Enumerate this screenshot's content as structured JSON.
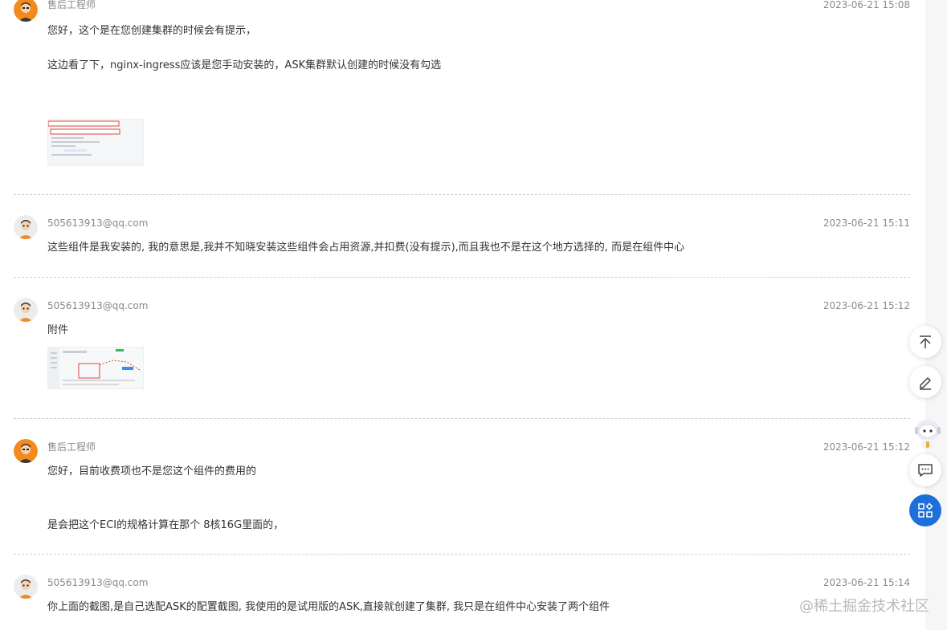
{
  "messages": [
    {
      "author": "售后工程师",
      "role": "engineer",
      "time": "2023-06-21 15:08",
      "lines": [
        "您好，这个是在您创建集群的时候会有提示，",
        "这边看了下，nginx-ingress应该是您手动安装的，ASK集群默认创建的时候没有勾选"
      ]
    },
    {
      "author": "505613913@qq.com",
      "role": "user",
      "time": "2023-06-21 15:11",
      "lines": [
        "这些组件是我安装的, 我的意思是,我并不知晓安装这些组件会占用资源,并扣费(没有提示),而且我也不是在这个地方选择的, 而是在组件中心"
      ]
    },
    {
      "author": "505613913@qq.com",
      "role": "user",
      "time": "2023-06-21 15:12",
      "lines": [
        "附件"
      ]
    },
    {
      "author": "售后工程师",
      "role": "engineer",
      "time": "2023-06-21 15:12",
      "lines": [
        "您好，目前收费项也不是您这个组件的费用的",
        "是会把这个ECI的规格计算在那个 8核16G里面的，"
      ]
    },
    {
      "author": "505613913@qq.com",
      "role": "user",
      "time": "2023-06-21 15:14",
      "lines": [
        "你上面的截图,是自己选配ASK的配置截图, 我使用的是试用版的ASK,直接就创建了集群, 我只是在组件中心安装了两个组件"
      ]
    }
  ],
  "attachments": [
    {
      "icon": "screenshot-thumbnail"
    },
    {
      "icon": "screenshot-thumbnail"
    }
  ],
  "floating_buttons": [
    {
      "icon": "back-to-top-icon"
    },
    {
      "icon": "edit-icon"
    },
    {
      "icon": "assistant-robot-icon"
    },
    {
      "icon": "feedback-icon"
    },
    {
      "icon": "apps-grid-icon"
    }
  ],
  "watermark": "@稀土掘金技术社区",
  "colors": {
    "accent_blue": "#1e6fd9",
    "engineer_avatar_bg": "#f28a1c",
    "user_avatar_bg": "#ececec",
    "muted_text": "#8a8a8a",
    "body_text": "#333333"
  }
}
